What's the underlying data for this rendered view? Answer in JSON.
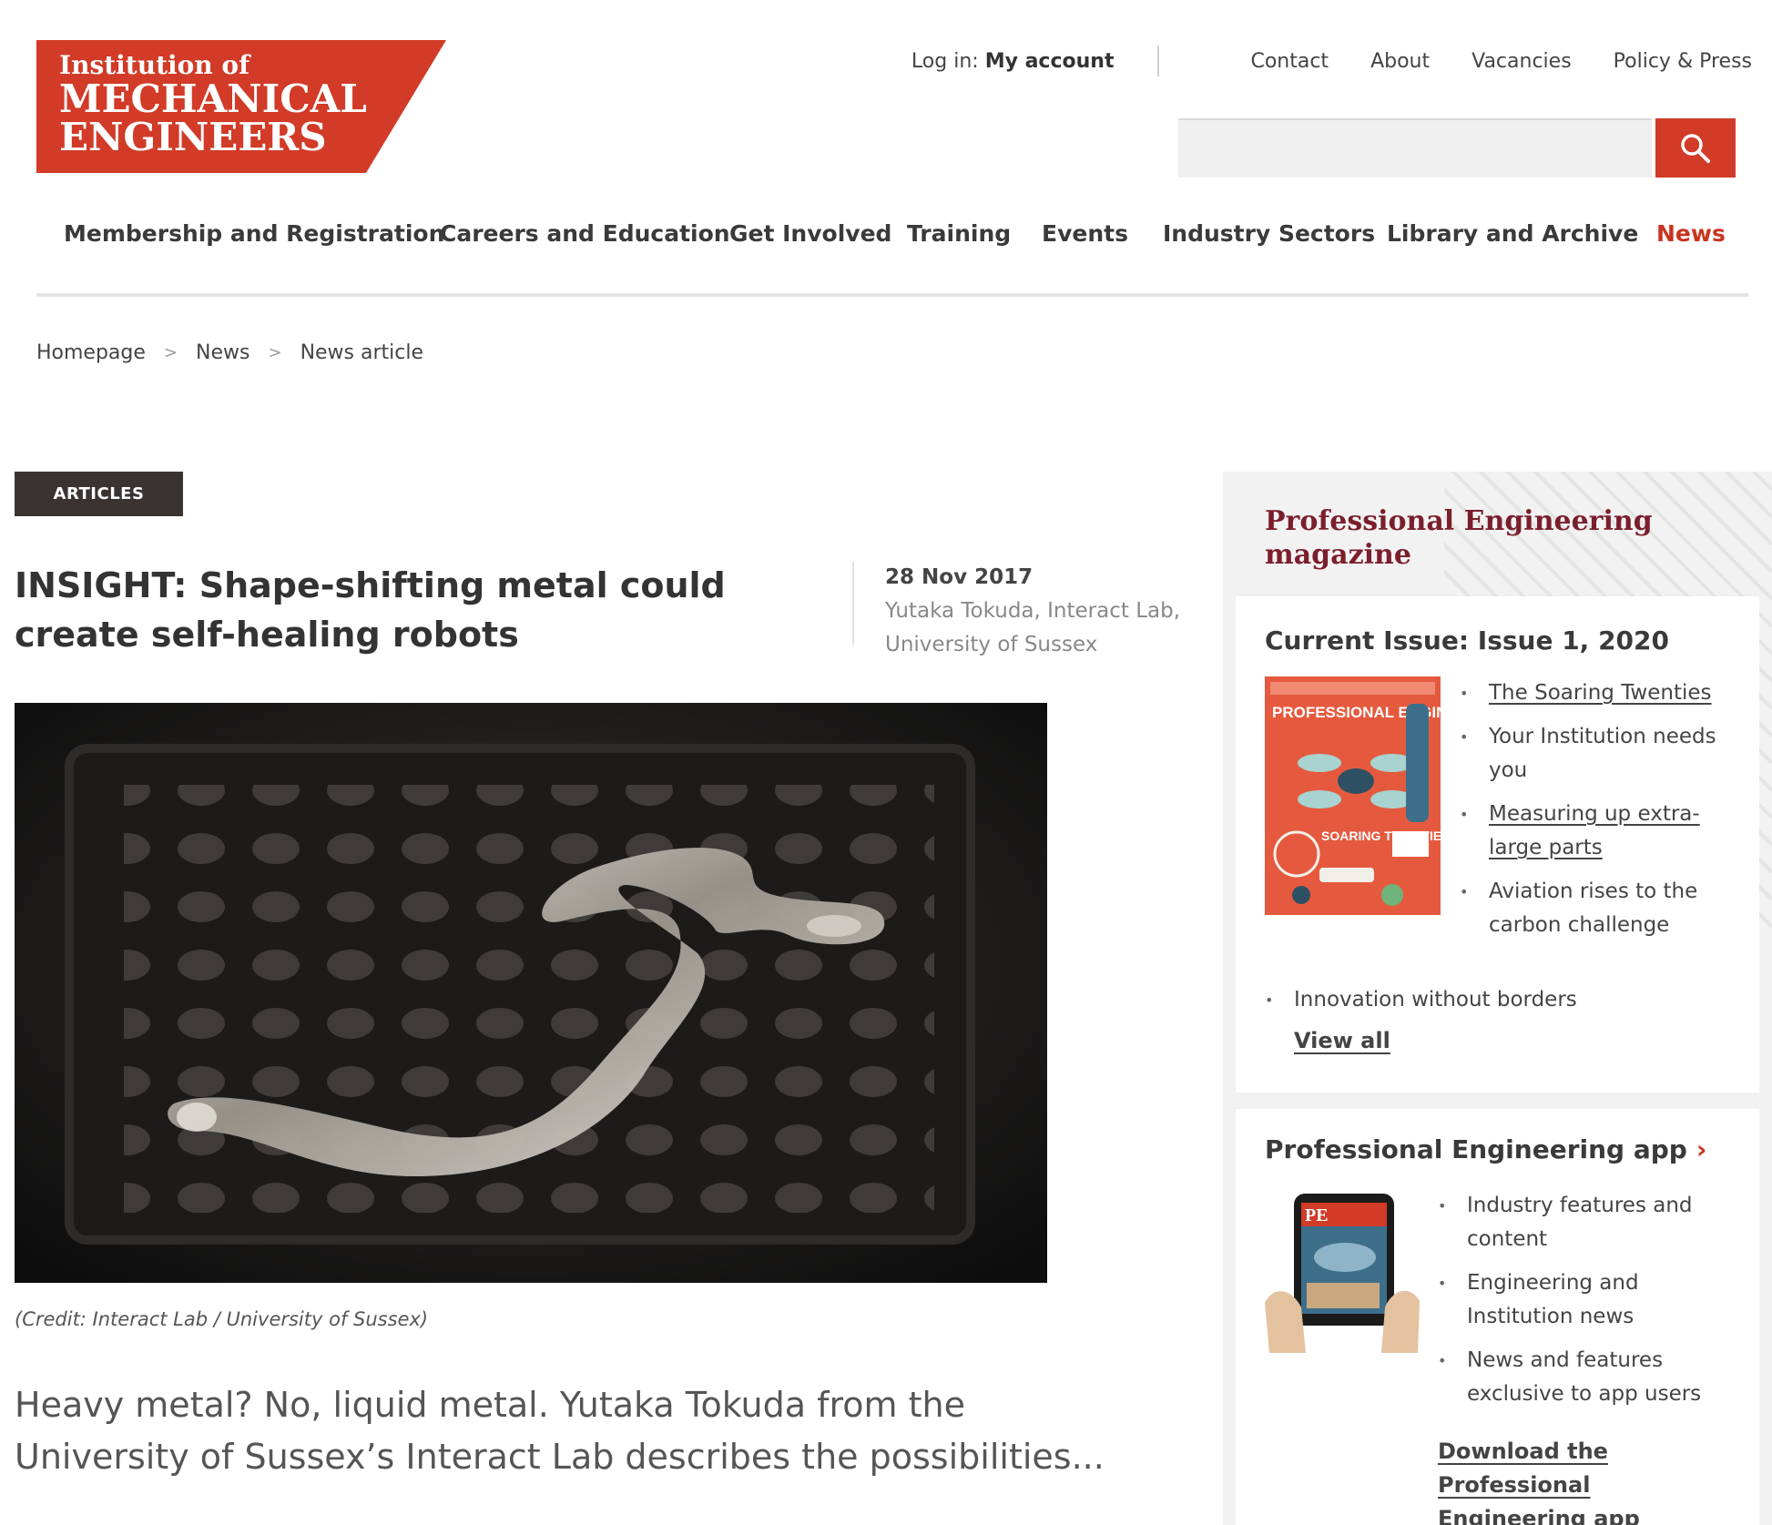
{
  "header": {
    "logo": {
      "line1": "Institution of",
      "line2": "MECHANICAL",
      "line3": "ENGINEERS",
      "color": "#d13b27"
    },
    "utility": {
      "login_prefix": "Log in:",
      "login_link": "My account",
      "links": [
        "Contact",
        "About",
        "Vacancies",
        "Policy & Press"
      ]
    },
    "search": {
      "placeholder": "",
      "icon": "search-icon"
    }
  },
  "nav": {
    "items": [
      "Membership and Registration",
      "Careers and Education",
      "Get Involved",
      "Training",
      "Events",
      "Industry Sectors",
      "Library and Archive",
      "News"
    ],
    "active": "News",
    "accent": "#c8341f"
  },
  "breadcrumb": {
    "items": [
      "Homepage",
      "News",
      "News article"
    ],
    "separator": ">"
  },
  "article": {
    "tag": "ARTICLES",
    "headline": "INSIGHT: Shape-shifting metal could create self-healing robots",
    "date": "28 Nov 2017",
    "author": "Yutaka Tokuda, Interact Lab, University of Sussex",
    "credit": "(Credit: Interact Lab / University of Sussex)",
    "standfirst": "Heavy metal? No, liquid metal. Yutaka Tokuda from the University of Sussex’s Interact Lab describes the possibilities..."
  },
  "sidebar": {
    "title": "Professional Engineering magazine",
    "title_color": "#7b1e2c",
    "current_issue": {
      "heading": "Current Issue: Issue 1, 2020",
      "cover": {
        "title": "PROFESSIONAL ENGINEERING",
        "headline": "SOARING TWENTIES"
      },
      "items": [
        "The Soaring Twenties",
        "Your Institution needs you",
        "Measuring up extra-large parts",
        "Aviation rises to the carbon challenge"
      ],
      "extra_item": "Innovation without borders",
      "view_all": "View all"
    },
    "app": {
      "heading": "Professional Engineering app",
      "chevron": "chevron-right-icon",
      "tablet_label": "PE",
      "items": [
        "Industry features and content",
        "Engineering and Institution news",
        "News and features exclusive to app users"
      ],
      "download": "Download the Professional Engineering app"
    }
  }
}
